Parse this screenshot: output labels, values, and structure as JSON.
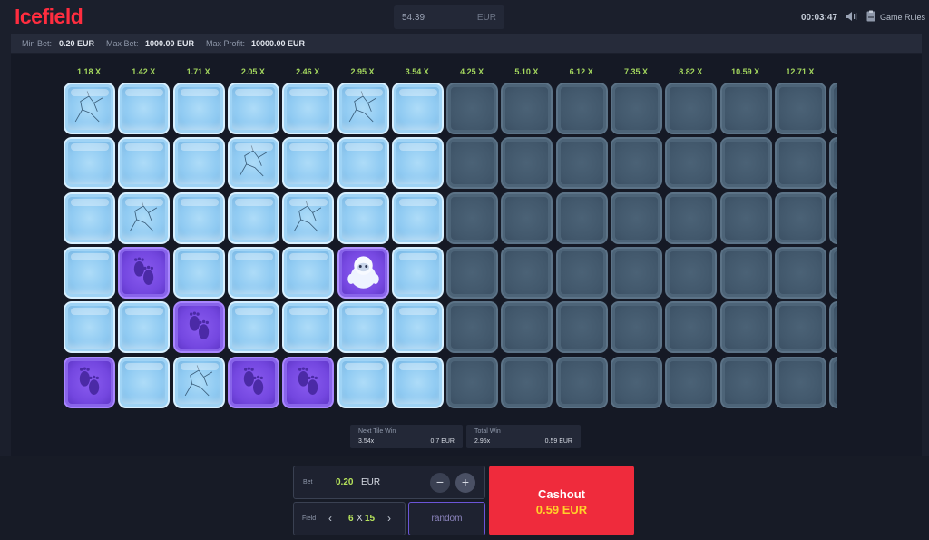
{
  "header": {
    "logo": "Icefield",
    "balance_amount": "54.39",
    "balance_currency": "EUR",
    "timer": "00:03:47",
    "game_rules_label": "Game Rules"
  },
  "limits": {
    "min_bet_label": "Min Bet:",
    "min_bet_value": "0.20 EUR",
    "max_bet_label": "Max Bet:",
    "max_bet_value": "1000.00 EUR",
    "max_profit_label": "Max Profit:",
    "max_profit_value": "10000.00 EUR"
  },
  "board": {
    "rows": 6,
    "columns": 15,
    "multipliers": [
      "1.18 X",
      "1.42 X",
      "1.71 X",
      "2.05 X",
      "2.46 X",
      "2.95 X",
      "3.54 X",
      "4.25 X",
      "5.10 X",
      "6.12 X",
      "7.35 X",
      "8.82 X",
      "10.59 X",
      "12.71 X"
    ],
    "grid": [
      [
        "ice-cracked",
        "ice",
        "ice",
        "ice",
        "ice",
        "ice-cracked",
        "ice",
        "dim",
        "dim",
        "dim",
        "dim",
        "dim",
        "dim",
        "dim",
        "dim"
      ],
      [
        "ice",
        "ice",
        "ice",
        "ice-cracked",
        "ice",
        "ice",
        "ice",
        "dim",
        "dim",
        "dim",
        "dim",
        "dim",
        "dim",
        "dim",
        "dim"
      ],
      [
        "ice",
        "ice-cracked",
        "ice",
        "ice",
        "ice-cracked",
        "ice",
        "ice",
        "dim",
        "dim",
        "dim",
        "dim",
        "dim",
        "dim",
        "dim",
        "dim"
      ],
      [
        "ice",
        "footprints",
        "ice",
        "ice",
        "ice",
        "yeti",
        "ice",
        "dim",
        "dim",
        "dim",
        "dim",
        "dim",
        "dim",
        "dim",
        "dim"
      ],
      [
        "ice",
        "ice",
        "footprints",
        "ice",
        "ice",
        "ice",
        "ice",
        "dim",
        "dim",
        "dim",
        "dim",
        "dim",
        "dim",
        "dim",
        "dim"
      ],
      [
        "footprints",
        "ice",
        "ice-cracked",
        "footprints",
        "footprints",
        "ice",
        "ice",
        "dim",
        "dim",
        "dim",
        "dim",
        "dim",
        "dim",
        "dim",
        "dim"
      ]
    ]
  },
  "next_tile_win": {
    "label": "Next Tile Win",
    "multiplier": "3.54x",
    "amount": "0.7 EUR"
  },
  "total_win": {
    "label": "Total Win",
    "multiplier": "2.95x",
    "amount": "0.59 EUR"
  },
  "bet": {
    "label": "Bet",
    "amount": "0.20",
    "currency": "EUR",
    "minus": "−",
    "plus": "+"
  },
  "field": {
    "label": "Field",
    "rows": "6",
    "separator": "X",
    "cols": "15",
    "prev": "‹",
    "next": "›"
  },
  "random_label": "random",
  "cashout": {
    "label": "Cashout",
    "amount": "0.59",
    "currency": "EUR"
  },
  "colors": {
    "brand": "#ff2d3f",
    "multiplier": "#a3d65e",
    "cashout": "#ef2b3c",
    "cashout_amount": "#ffd02a",
    "footprint_tile": "#7447e0"
  }
}
